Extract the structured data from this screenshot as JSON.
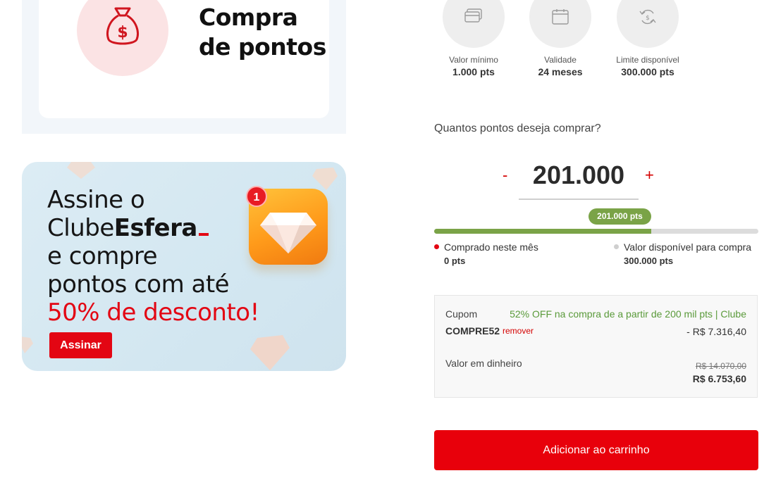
{
  "hero": {
    "title_line1": "Compra",
    "title_line2": "de pontos",
    "icon": "money-bag-icon"
  },
  "banner": {
    "line1": "Assine o",
    "line2_light": "Clube",
    "line2_bold": "Esfera",
    "line3": "e compre",
    "line4": "pontos com até",
    "line5": "50% de desconto!",
    "badge_count": "1",
    "button_label": "Assinar",
    "icon": "diamond-icon",
    "colors": {
      "accent": "#e30613",
      "background": "#d6e9f2"
    }
  },
  "features": [
    {
      "icon": "card-icon",
      "label": "Valor mínimo",
      "value": "1.000 pts"
    },
    {
      "icon": "calendar-icon",
      "label": "Validade",
      "value": "24 meses"
    },
    {
      "icon": "refresh-icon",
      "label": "Limite disponível",
      "value": "300.000 pts"
    }
  ],
  "purchase": {
    "question": "Quantos pontos deseja comprar?",
    "decrement": "-",
    "increment": "+",
    "quantity": "201.000",
    "tooltip": "201.000 pts",
    "progress_fraction": 0.67
  },
  "legend": {
    "bought_label": "Comprado neste mês",
    "bought_value": "0 pts",
    "available_label": "Valor disponível para compra",
    "available_value": "300.000 pts"
  },
  "coupon": {
    "label": "Cupom",
    "promo": "52% OFF na compra de a partir de 200 mil pts | Clube",
    "code": "COMPRE52",
    "remove_label": "remover",
    "discount": "- R$ 7.316,40",
    "cash_label": "Valor em dinheiro",
    "old_price": "R$ 14.070,00",
    "new_price": "R$ 6.753,60"
  },
  "cart_button": "Adicionar ao carrinho",
  "colors": {
    "primary": "#e8000b",
    "success": "#7aa347",
    "text": "#333333"
  }
}
